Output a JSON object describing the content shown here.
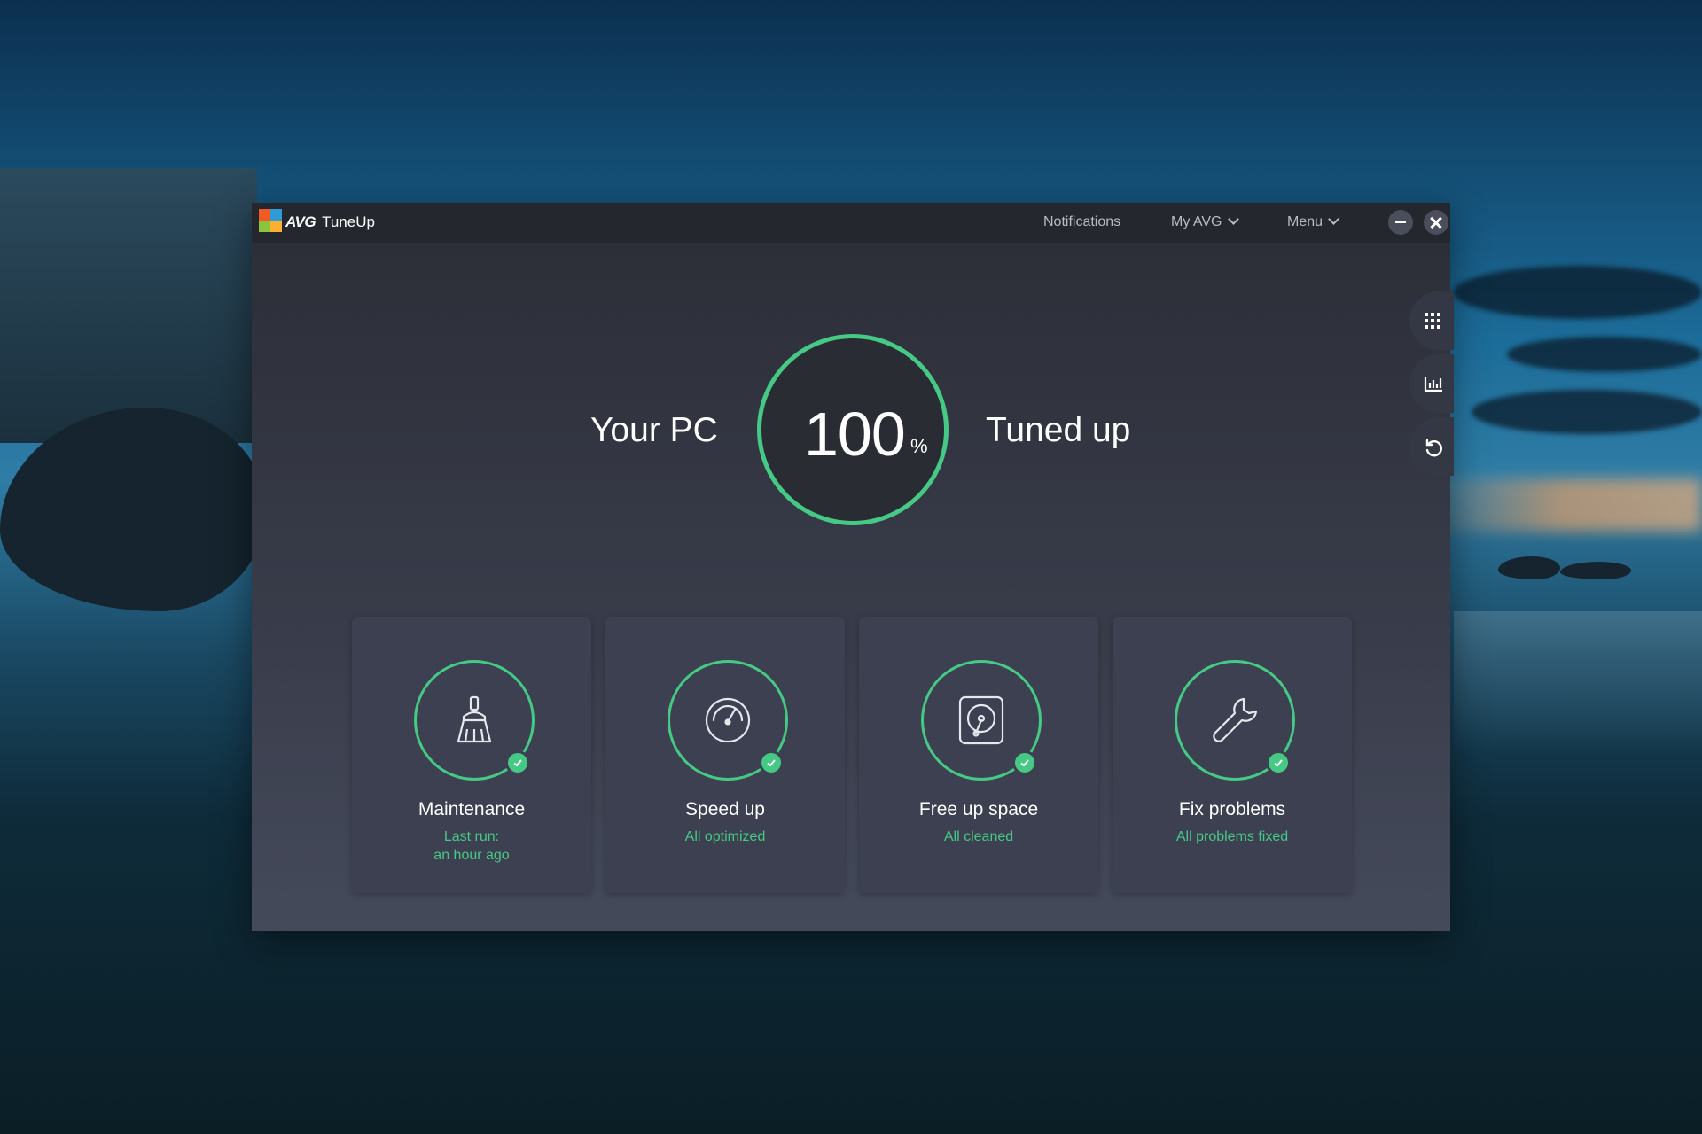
{
  "app": {
    "brand": "AVG",
    "product": "TuneUp"
  },
  "header": {
    "notifications": "Notifications",
    "my_avg": "My AVG",
    "menu": "Menu"
  },
  "hero": {
    "left_text": "Your PC",
    "score": "100",
    "unit": "%",
    "right_text": "Tuned up"
  },
  "cards": [
    {
      "title": "Maintenance",
      "status_line1": "Last run:",
      "status_line2": "an hour ago",
      "icon": "broom-icon"
    },
    {
      "title": "Speed up",
      "status_line1": "All optimized",
      "icon": "speedometer-icon"
    },
    {
      "title": "Free up space",
      "status_line1": "All cleaned",
      "icon": "hard-drive-icon"
    },
    {
      "title": "Fix problems",
      "status_line1": "All problems fixed",
      "icon": "wrench-icon"
    }
  ],
  "side_tools": [
    "apps-grid-icon",
    "stats-chart-icon",
    "undo-icon"
  ],
  "colors": {
    "accent": "#45c985",
    "window_bg": "#393d4b",
    "card_bg": "#3c4050",
    "titlebar": "#25272e"
  }
}
